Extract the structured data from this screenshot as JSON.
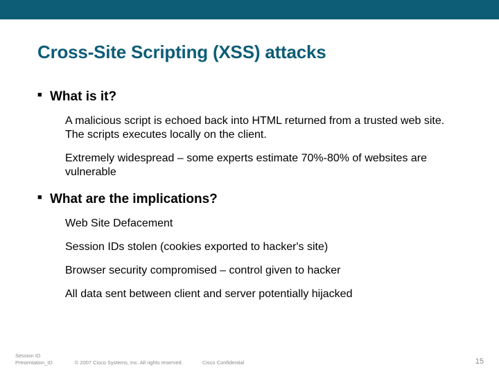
{
  "title": "Cross-Site Scripting (XSS) attacks",
  "sections": [
    {
      "heading": "What is it?",
      "points": [
        "A malicious script is echoed back into HTML returned from a trusted web site. The scripts executes locally on the client.",
        "Extremely widespread – some experts estimate 70%-80% of websites are vulnerable"
      ]
    },
    {
      "heading": "What are the implications?",
      "points": [
        "Web Site Defacement",
        "Session IDs stolen (cookies exported to hacker's site)",
        "Browser security compromised – control given to hacker",
        "All data sent between client and server potentially hijacked"
      ]
    }
  ],
  "footer": {
    "left1": "Session ID",
    "left2": "Presentation_ID",
    "copyright": "© 2007 Cisco Systems, Inc. All rights reserved.",
    "confidential": "Cisco Confidential",
    "page": "15"
  }
}
